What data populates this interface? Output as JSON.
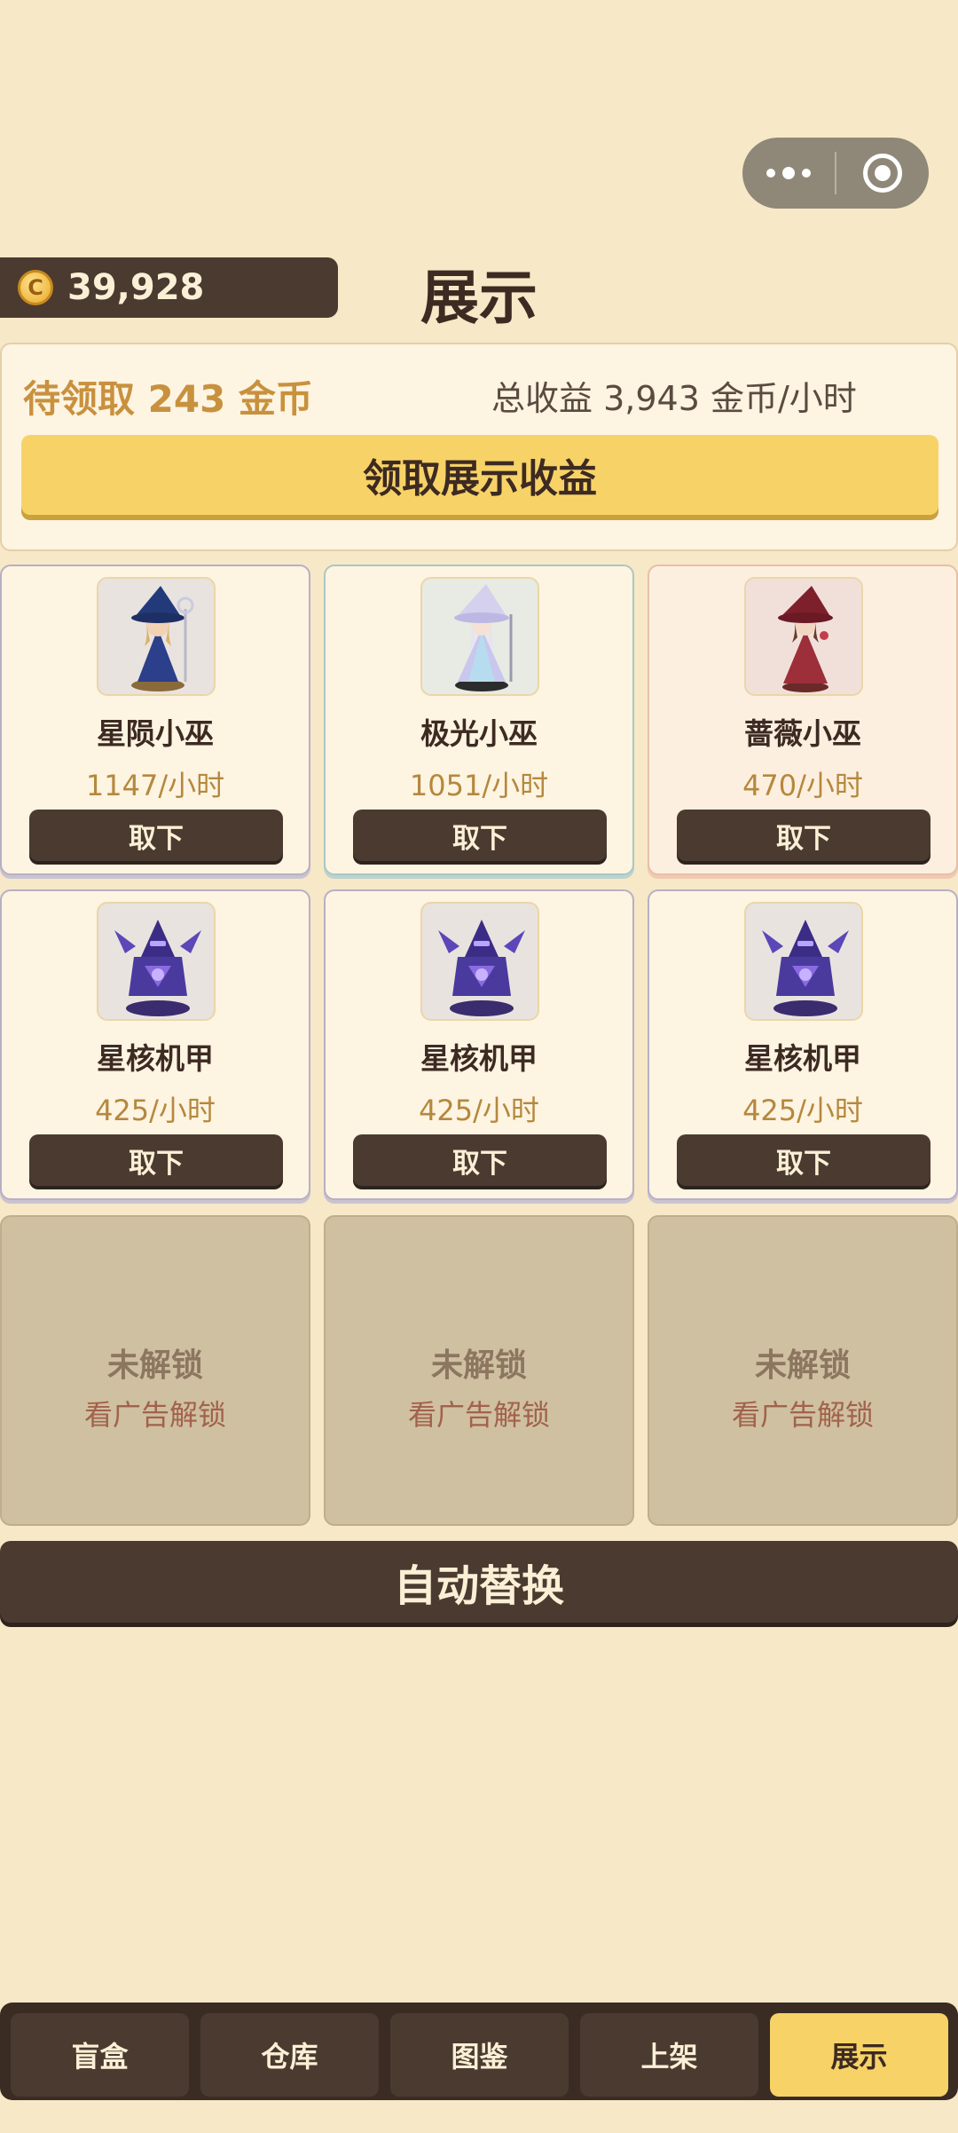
{
  "header": {
    "title": "展示",
    "coin_balance": "39,928",
    "coin_icon_glyph": "C"
  },
  "earnings": {
    "pending": "待领取 243 金币",
    "total": "总收益 3,943 金币/小时",
    "claim_label": "领取展示收益"
  },
  "slots": [
    {
      "name": "星陨小巫",
      "rate": "1147/小时",
      "action": "取下",
      "theme": "wizard-blue"
    },
    {
      "name": "极光小巫",
      "rate": "1051/小时",
      "action": "取下",
      "theme": "wizard-aurora"
    },
    {
      "name": "蔷薇小巫",
      "rate": "470/小时",
      "action": "取下",
      "theme": "wizard-rose"
    },
    {
      "name": "星核机甲",
      "rate": "425/小时",
      "action": "取下",
      "theme": "mech-purple"
    },
    {
      "name": "星核机甲",
      "rate": "425/小时",
      "action": "取下",
      "theme": "mech-purple"
    },
    {
      "name": "星核机甲",
      "rate": "425/小时",
      "action": "取下",
      "theme": "mech-purple"
    }
  ],
  "locked_slots": [
    {
      "title": "未解锁",
      "action": "看广告解锁"
    },
    {
      "title": "未解锁",
      "action": "看广告解锁"
    },
    {
      "title": "未解锁",
      "action": "看广告解锁"
    }
  ],
  "auto_replace_label": "自动替换",
  "tabs": [
    {
      "label": "盲盒",
      "active": false
    },
    {
      "label": "仓库",
      "active": false
    },
    {
      "label": "图鉴",
      "active": false
    },
    {
      "label": "上架",
      "active": false
    },
    {
      "label": "展示",
      "active": true
    }
  ],
  "colors": {
    "background": "#f7e8c7",
    "dark_brown": "#4b3a30",
    "gold": "#f7d367",
    "accent_text": "#c8913e"
  }
}
